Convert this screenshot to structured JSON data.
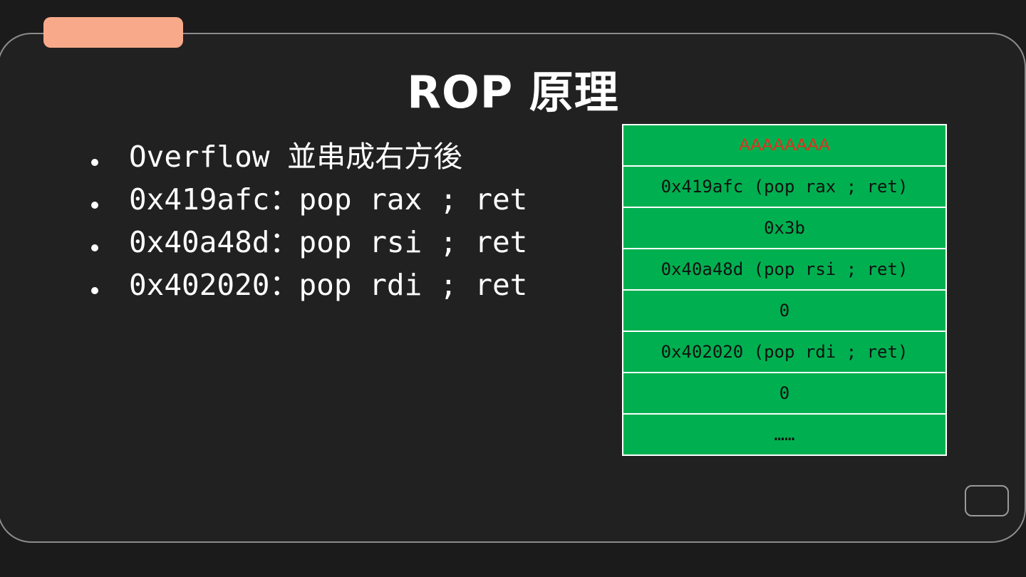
{
  "slide": {
    "title": "ROP 原理",
    "bullets": [
      "Overflow 並串成右方後",
      "0x419afc：pop rax ; ret",
      "0x40a48d：pop rsi ; ret",
      "0x402020：pop rdi ; ret"
    ]
  },
  "stack": {
    "rows": [
      "AAAAAAAA",
      "0x419afc (pop rax ; ret)",
      "0x3b",
      "0x40a48d (pop rsi ; ret)",
      "0",
      "0x402020 (pop rdi ; ret)",
      "0",
      "……"
    ]
  },
  "colors": {
    "background": "#1b1b1b",
    "panel": "#212121",
    "accent_tab": "#f7a98a",
    "stack_cell": "#00b050",
    "padding_text": "#e0301e"
  }
}
